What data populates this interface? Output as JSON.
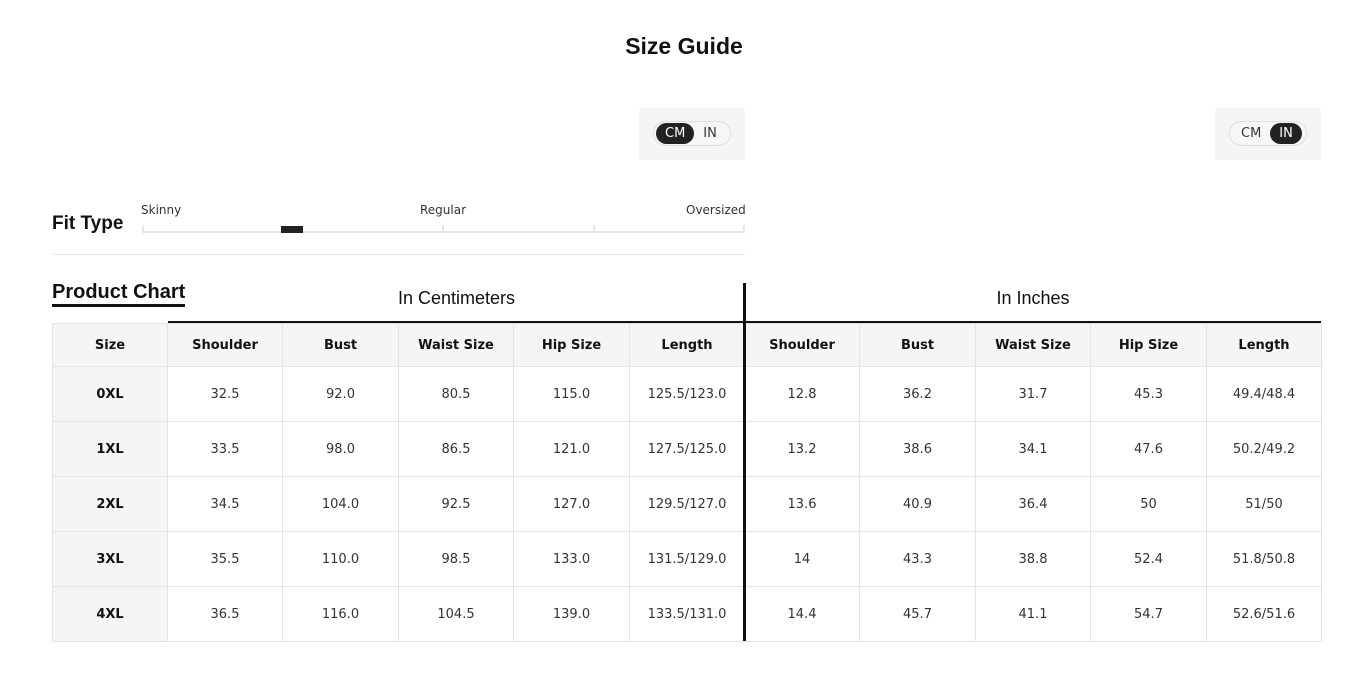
{
  "page_title": "Size Guide",
  "unit_toggle_left": {
    "cm": "CM",
    "in": "IN",
    "active": "CM"
  },
  "unit_toggle_right": {
    "cm": "CM",
    "in": "IN",
    "active": "IN"
  },
  "fit_type": {
    "label": "Fit Type",
    "scale": [
      "Skinny",
      "Regular",
      "Oversized"
    ],
    "level_fraction": 0.25
  },
  "product_chart": {
    "title": "Product Chart",
    "group_cm": "In Centimeters",
    "group_in": "In Inches",
    "headers": [
      "Size",
      "Shoulder",
      "Bust",
      "Waist Size",
      "Hip Size",
      "Length",
      "Shoulder",
      "Bust",
      "Waist Size",
      "Hip Size",
      "Length"
    ],
    "rows": [
      [
        "0XL",
        "32.5",
        "92.0",
        "80.5",
        "115.0",
        "125.5/123.0",
        "12.8",
        "36.2",
        "31.7",
        "45.3",
        "49.4/48.4"
      ],
      [
        "1XL",
        "33.5",
        "98.0",
        "86.5",
        "121.0",
        "127.5/125.0",
        "13.2",
        "38.6",
        "34.1",
        "47.6",
        "50.2/49.2"
      ],
      [
        "2XL",
        "34.5",
        "104.0",
        "92.5",
        "127.0",
        "129.5/127.0",
        "13.6",
        "40.9",
        "36.4",
        "50",
        "51/50"
      ],
      [
        "3XL",
        "35.5",
        "110.0",
        "98.5",
        "133.0",
        "131.5/129.0",
        "14",
        "43.3",
        "38.8",
        "52.4",
        "51.8/50.8"
      ],
      [
        "4XL",
        "36.5",
        "116.0",
        "104.5",
        "139.0",
        "133.5/131.0",
        "14.4",
        "45.7",
        "41.1",
        "54.7",
        "52.6/51.6"
      ]
    ]
  }
}
